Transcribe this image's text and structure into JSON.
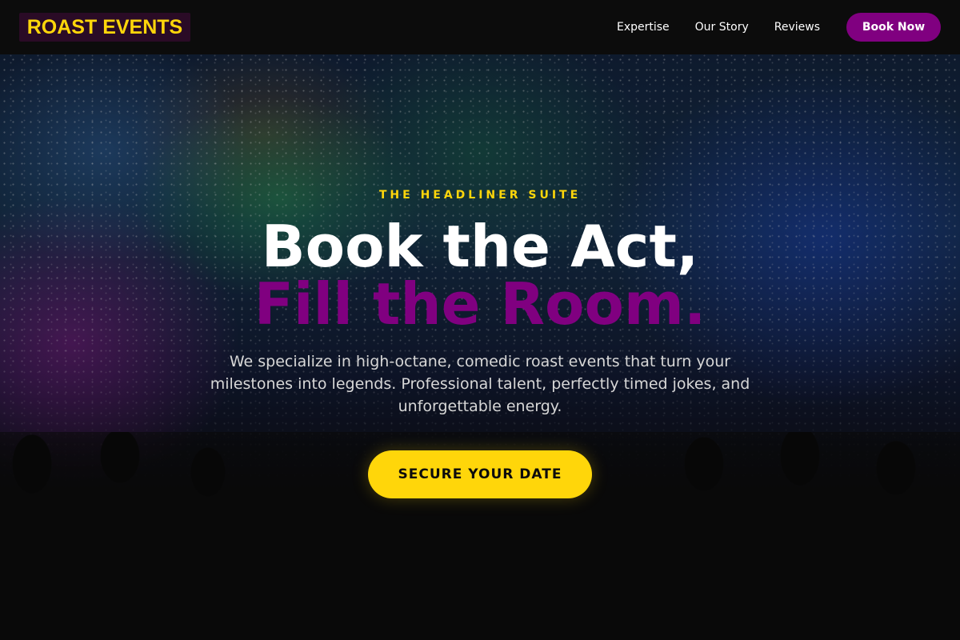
{
  "nav": {
    "logo": "ROAST EVENTS",
    "links": [
      "Expertise",
      "Our Story",
      "Reviews"
    ],
    "book_button": "Book Now"
  },
  "hero": {
    "eyebrow": "THE HEADLINER SUITE",
    "headline_line1": "Book the Act,",
    "headline_line2": "Fill the Room.",
    "description": "We specialize in high-octane, comedic roast events that turn your milestones into legends. Professional talent, perfectly timed jokes, and unforgettable energy.",
    "cta_label": "SECURE YOUR DATE",
    "background_image": "concert-crowd-image"
  },
  "colors": {
    "accent_yellow": "#ffd60a",
    "accent_purple": "#800080",
    "background": "#0c0c0c"
  }
}
